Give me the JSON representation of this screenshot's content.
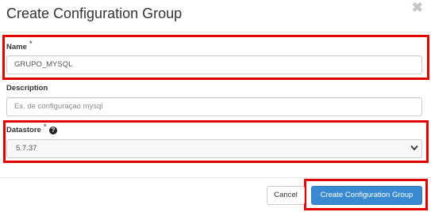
{
  "modal": {
    "title": "Create Configuration Group",
    "close_glyph": "✖",
    "close_icon": "close-icon"
  },
  "form": {
    "name": {
      "label": "Name",
      "required_mark": "*",
      "value": "GRUPO_MYSQL"
    },
    "description": {
      "label": "Description",
      "placeholder": "Ex. de configuraçao mysql"
    },
    "datastore": {
      "label": "Datastore",
      "required_mark": "*",
      "help_glyph": "?",
      "help_icon": "question-circle-icon",
      "selected": "5.7.37",
      "chevron_icon": "chevron-down-icon"
    }
  },
  "footer": {
    "cancel_label": "Cancel",
    "submit_label": "Create Configuration Group"
  },
  "colors": {
    "primary": "#3a8ad1",
    "highlight": "#e50000"
  }
}
